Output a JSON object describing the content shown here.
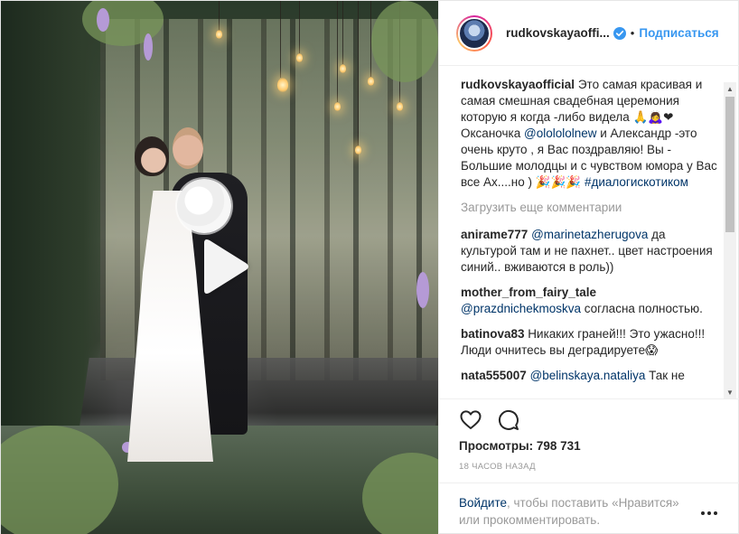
{
  "post": {
    "username": "rudkovskayaofficial",
    "username_truncated": "rudkovskayaoffi...",
    "separator": "•",
    "follow_label": "Подписаться",
    "caption_parts": [
      "Это самая красивая и самая смешная свадебная церемония которую я когда -либо видела 🙏🙇‍♀️❤ Оксаночка ",
      "@ololololnew",
      " и Александр -это очень круто , я Вас поздравляю! Вы - Большие молодцы и с чувством юмора у Вас все Ах....но ) 🎉🎉🎉 ",
      "#диалогискотиком"
    ],
    "load_more_label": "Загрузить еще комментарии",
    "comments": [
      {
        "user": "anirame777",
        "mention": "@marinetazherugova",
        "text": " да культурой там и не пахнет.. цвет настроения синий.. вживаются в роль))"
      },
      {
        "user": "mother_from_fairy_tale",
        "mention": "@prazdnichekmoskva",
        "text": " согласна полностью."
      },
      {
        "user": "batinova83",
        "mention": "",
        "text": " Никаких граней!!! Это ужасно!!! Люди очнитесь вы деградируете😱"
      },
      {
        "user": "nata555007",
        "mention": "@belinskaya.nataliya",
        "text": " Так не"
      }
    ],
    "views_label": "Просмотры: 798 731",
    "timestamp": "18 ЧАСОВ НАЗАД",
    "login_link": "Войдите",
    "login_text": ", чтобы поставить «Нравится» или прокомментировать."
  },
  "icons": {
    "play": "play-icon",
    "verified": "verified-badge-icon",
    "like": "heart-icon",
    "comment": "comment-bubble-icon",
    "more": "more-dots-icon",
    "scroll_up": "triangle-up-icon",
    "scroll_down": "triangle-down-icon"
  },
  "colors": {
    "link_blue": "#3897f0",
    "mention_blue": "#003569",
    "muted": "#999999",
    "text": "#262626"
  }
}
